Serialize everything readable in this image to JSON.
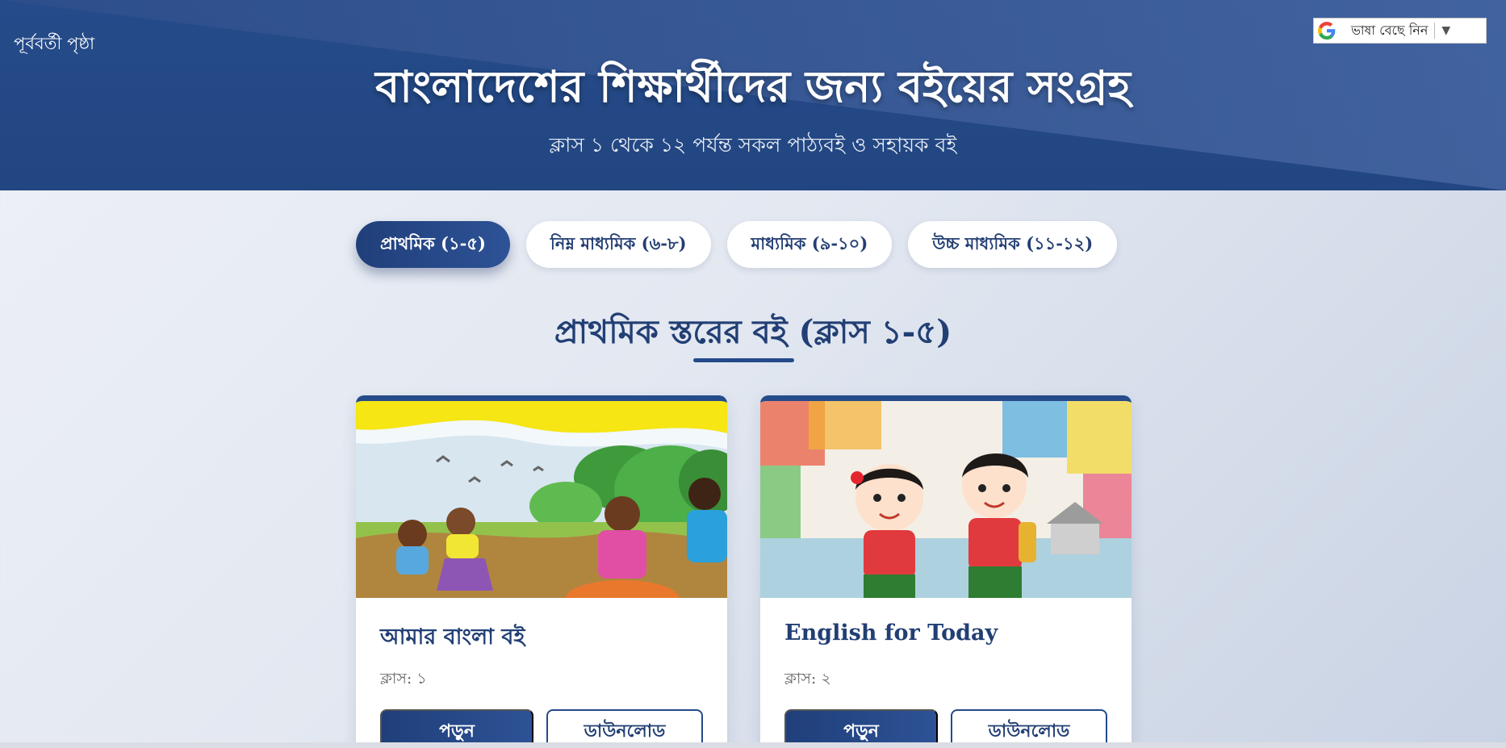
{
  "header": {
    "back_link": "পূর্ববর্তী পৃষ্ঠা",
    "language_selector": {
      "label": "ভাষা বেছে নিন",
      "caret": "▼",
      "icon": "google-g-icon"
    },
    "title": "বাংলাদেশের শিক্ষার্থীদের জন্য বইয়ের সংগ্রহ",
    "subtitle": "ক্লাস ১ থেকে ১২ পর্যন্ত সকল পাঠ্যবই ও সহায়ক বই"
  },
  "tabs": [
    {
      "label": "প্রাথমিক (১-৫)",
      "active": true
    },
    {
      "label": "নিম্ন মাধ্যমিক (৬-৮)",
      "active": false
    },
    {
      "label": "মাধ্যমিক (৯-১০)",
      "active": false
    },
    {
      "label": "উচ্চ মাধ্যমিক (১১-১২)",
      "active": false
    }
  ],
  "section": {
    "title": "প্রাথমিক স্তরের বই (ক্লাস ১-৫)"
  },
  "books": [
    {
      "title": "আমার বাংলা বই",
      "class_label": "ক্লাস: ১",
      "read_label": "পড়ুন",
      "download_label": "ডাউনলোড"
    },
    {
      "title": "English for Today",
      "class_label": "ক্লাস: ২",
      "read_label": "পড়ুন",
      "download_label": "ডাউনলোড"
    }
  ],
  "colors": {
    "primary": "#254b8a",
    "primary_dark": "#203f7a",
    "text_heading": "#223f74",
    "background": "#e3e8f1"
  }
}
